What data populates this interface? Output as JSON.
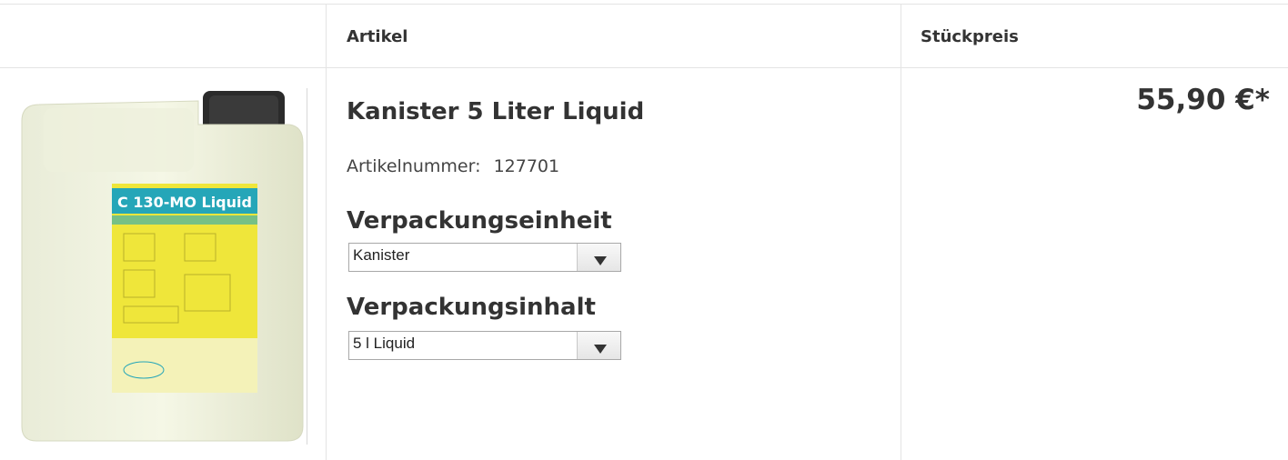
{
  "table": {
    "headers": [
      "",
      "Artikel",
      "Stückpreis"
    ]
  },
  "product": {
    "image_icon": "canister-image",
    "image_label": "C 130-MO Liquid",
    "title": "Kanister 5 Liter Liquid",
    "article_number_label": "Artikelnummer:",
    "article_number": "127701",
    "packaging_unit_heading": "Verpackungseinheit",
    "packaging_unit_value": "Kanister",
    "packaging_content_heading": "Verpackungsinhalt",
    "packaging_content_value": "5 l Liquid",
    "price": "55,90 €*"
  }
}
